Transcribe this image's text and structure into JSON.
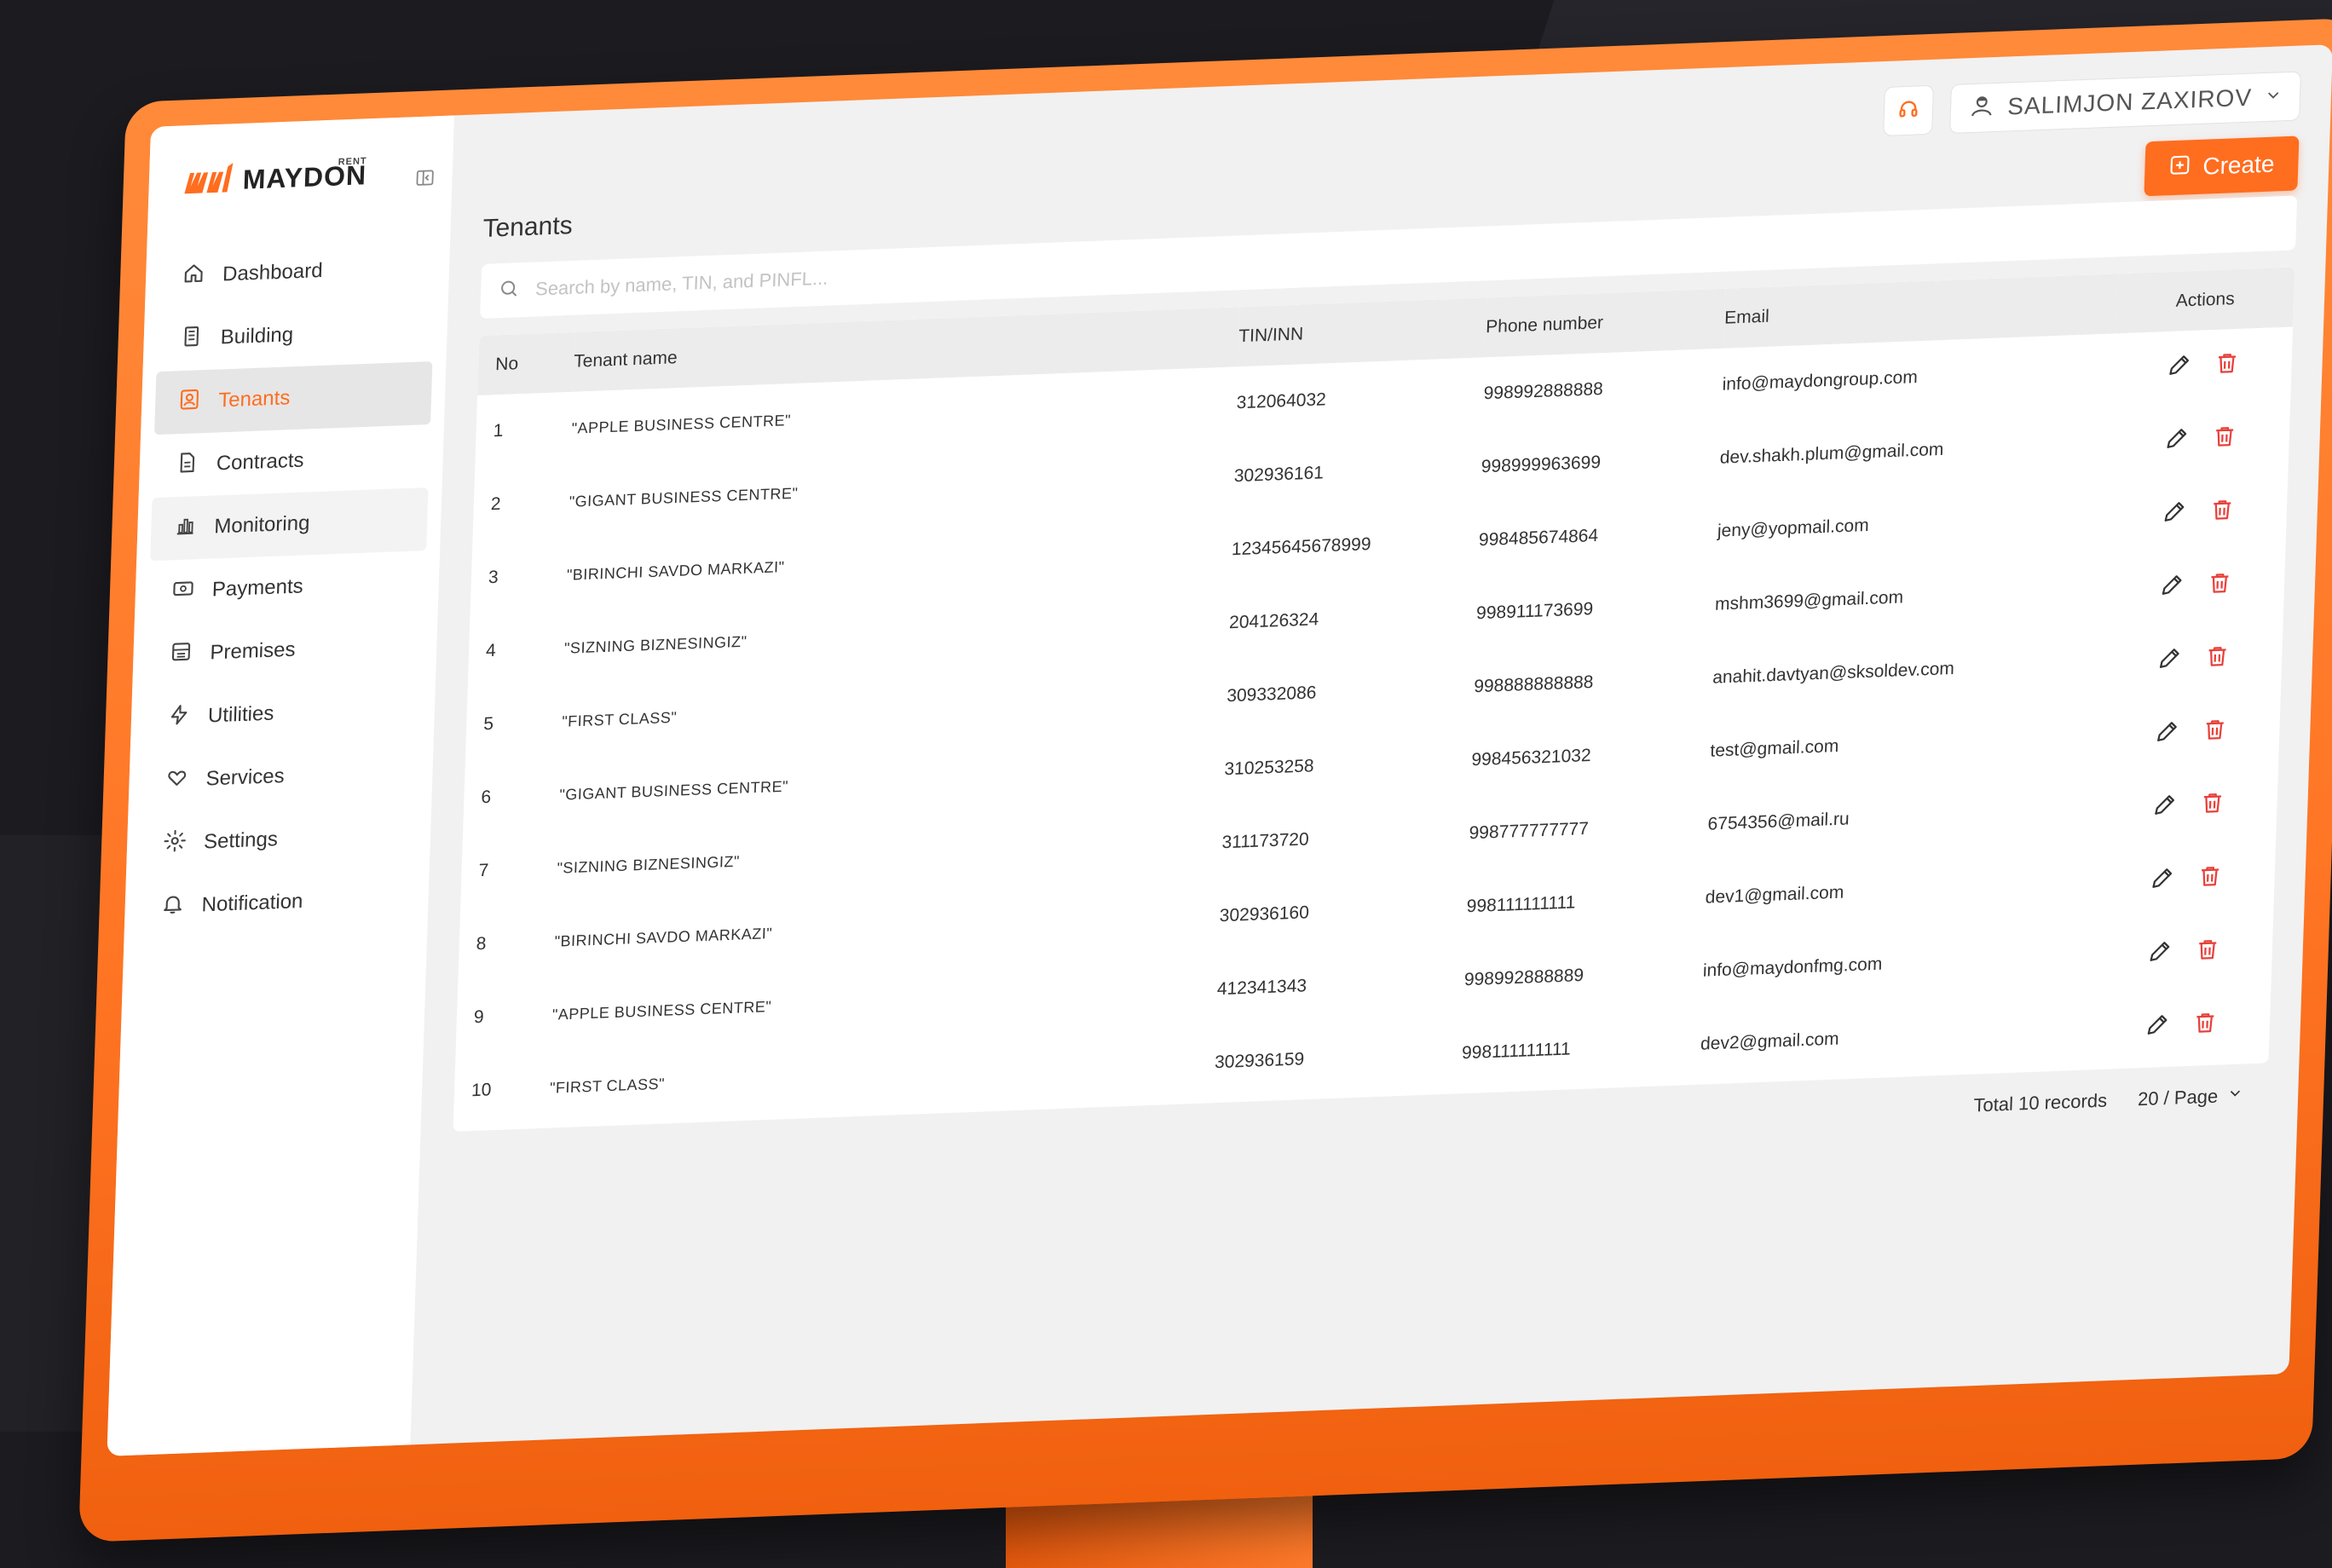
{
  "app": {
    "logo_text": "MAYDON",
    "logo_sup": "RENT",
    "brand_color": "#ff6d1f"
  },
  "sidebar": {
    "items": [
      {
        "label": "Dashboard",
        "icon": "home-icon"
      },
      {
        "label": "Building",
        "icon": "building-icon"
      },
      {
        "label": "Tenants",
        "icon": "tenant-icon",
        "active": true
      },
      {
        "label": "Contracts",
        "icon": "document-icon"
      },
      {
        "label": "Monitoring",
        "icon": "chart-icon"
      },
      {
        "label": "Payments",
        "icon": "payment-icon"
      },
      {
        "label": "Premises",
        "icon": "premises-icon"
      },
      {
        "label": "Utilities",
        "icon": "lightning-icon"
      },
      {
        "label": "Services",
        "icon": "heart-hand-icon"
      },
      {
        "label": "Settings",
        "icon": "gear-icon"
      },
      {
        "label": "Notification",
        "icon": "bell-icon"
      }
    ]
  },
  "header": {
    "user_name": "SALIMJON ZAXIROV",
    "create_label": "Create"
  },
  "page": {
    "title": "Tenants",
    "search_placeholder": "Search by name, TIN, and PINFL..."
  },
  "table": {
    "columns": {
      "no": "No",
      "name": "Tenant name",
      "tin": "TIN/INN",
      "phone": "Phone number",
      "email": "Email",
      "actions": "Actions"
    },
    "rows": [
      {
        "no": "1",
        "name": "\"APPLE BUSINESS CENTRE\"",
        "tin": "312064032",
        "phone": "998992888888",
        "email": "info@maydongroup.com"
      },
      {
        "no": "2",
        "name": "\"GIGANT BUSINESS CENTRE\"",
        "tin": "302936161",
        "phone": "998999963699",
        "email": "dev.shakh.plum@gmail.com"
      },
      {
        "no": "3",
        "name": "\"BIRINCHI SAVDO MARKAZI\"",
        "tin": "12345645678999",
        "phone": "998485674864",
        "email": "jeny@yopmail.com"
      },
      {
        "no": "4",
        "name": "\"SIZNING BIZNESINGIZ\"",
        "tin": "204126324",
        "phone": "998911173699",
        "email": "mshm3699@gmail.com"
      },
      {
        "no": "5",
        "name": "\"FIRST CLASS\"",
        "tin": "309332086",
        "phone": "998888888888",
        "email": "anahit.davtyan@sksoldev.com"
      },
      {
        "no": "6",
        "name": "\"GIGANT BUSINESS CENTRE\"",
        "tin": "310253258",
        "phone": "998456321032",
        "email": "test@gmail.com"
      },
      {
        "no": "7",
        "name": "\"SIZNING BIZNESINGIZ\"",
        "tin": "311173720",
        "phone": "998777777777",
        "email": "6754356@mail.ru"
      },
      {
        "no": "8",
        "name": "\"BIRINCHI SAVDO MARKAZI\"",
        "tin": "302936160",
        "phone": "998111111111",
        "email": "dev1@gmail.com"
      },
      {
        "no": "9",
        "name": "\"APPLE BUSINESS CENTRE\"",
        "tin": "412341343",
        "phone": "998992888889",
        "email": "info@maydonfmg.com"
      },
      {
        "no": "10",
        "name": "\"FIRST CLASS\"",
        "tin": "302936159",
        "phone": "998111111111",
        "email": "dev2@gmail.com"
      }
    ]
  },
  "footer": {
    "total_records": "Total 10 records",
    "page_size": "20 / Page"
  }
}
